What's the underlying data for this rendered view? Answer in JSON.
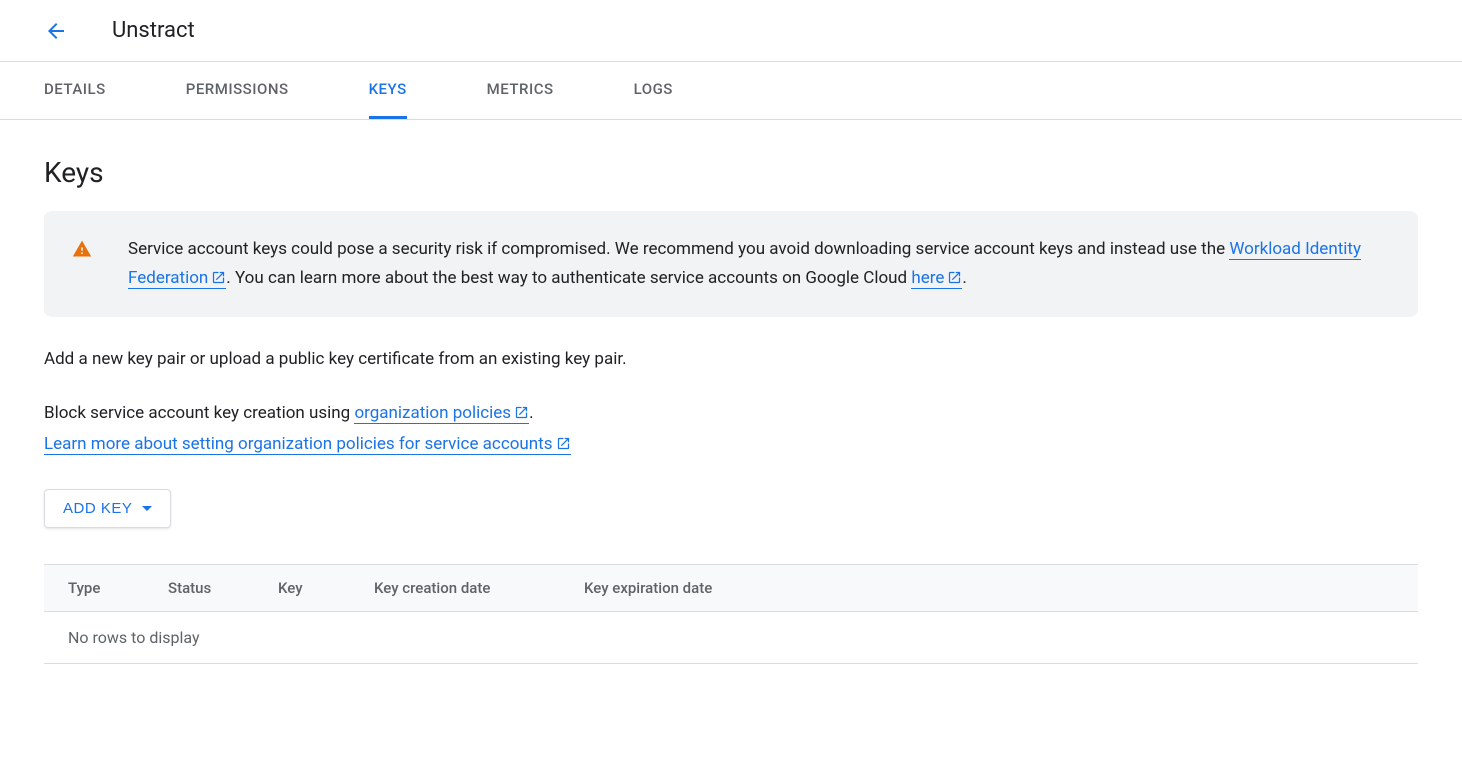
{
  "header": {
    "title": "Unstract"
  },
  "tabs": [
    {
      "label": "DETAILS",
      "active": false
    },
    {
      "label": "PERMISSIONS",
      "active": false
    },
    {
      "label": "KEYS",
      "active": true
    },
    {
      "label": "METRICS",
      "active": false
    },
    {
      "label": "LOGS",
      "active": false
    }
  ],
  "main": {
    "heading": "Keys",
    "warning": {
      "text_before_link1": "Service account keys could pose a security risk if compromised. We recommend you avoid downloading service account keys and instead use the ",
      "link1_text": "Workload Identity Federation",
      "text_mid": ". You can learn more about the best way to authenticate service accounts on Google Cloud ",
      "link2_text": "here",
      "text_after": "."
    },
    "description": "Add a new key pair or upload a public key certificate from an existing key pair.",
    "block_policy": {
      "prefix": "Block service account key creation using ",
      "link1_text": "organization policies",
      "suffix1": ".",
      "link2_text": "Learn more about setting organization policies for service accounts"
    },
    "add_key_button": "ADD KEY",
    "table": {
      "columns": [
        "Type",
        "Status",
        "Key",
        "Key creation date",
        "Key expiration date"
      ],
      "empty_message": "No rows to display"
    }
  }
}
